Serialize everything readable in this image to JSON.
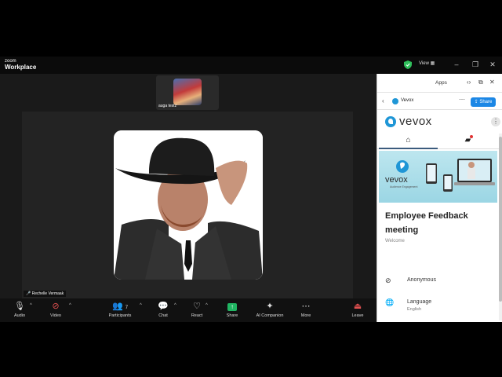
{
  "app": {
    "brand_small": "zoom",
    "brand_big": "Workplace",
    "view_label": "View"
  },
  "thumbnail": {
    "name": "auga testz"
  },
  "speaker": {
    "name": "Rechelle Vermaak"
  },
  "toolbar": {
    "audio": "Audio",
    "video": "Video",
    "participants": "Participants",
    "participants_count": "7",
    "chat": "Chat",
    "react": "React",
    "share": "Share",
    "ai": "AI Companion",
    "more": "More",
    "leave": "Leave"
  },
  "panel": {
    "title": "Apps",
    "app_name": "Vevox",
    "share_label": "Share",
    "logo_text": "vevox",
    "banner_logo": "vevox",
    "banner_sub": "Audience Engagement",
    "event_title": "Employee Feedback meeting",
    "welcome": "Welcome",
    "rows": [
      {
        "icon": "eye-slash-icon",
        "label": "Anonymous"
      },
      {
        "icon": "globe-icon",
        "label": "Language",
        "sub": "English"
      }
    ]
  },
  "colors": {
    "accent": "#1c87e5",
    "brand": "#1f96d6",
    "shield": "#2fbf5b",
    "share_green": "#20b562"
  }
}
